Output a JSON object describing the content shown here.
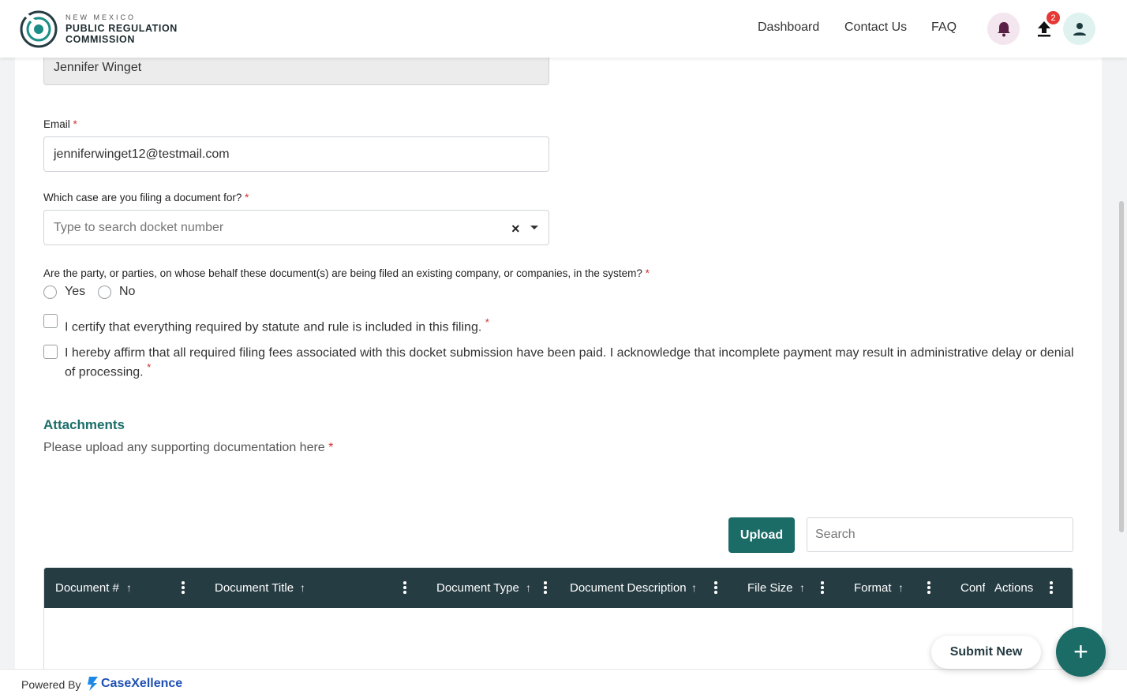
{
  "header": {
    "org_line1": "NEW MEXICO",
    "org_line2": "PUBLIC REGULATION",
    "org_line3": "COMMISSION",
    "nav": [
      "Dashboard",
      "Contact Us",
      "FAQ"
    ],
    "upload_badge": "2"
  },
  "form": {
    "name_value": "Jennifer Winget",
    "email_label": "Email",
    "email_value": "jenniferwinget12@testmail.com",
    "case_label": "Which case are you filing a document for?",
    "case_placeholder": "Type to search docket number",
    "party_question": "Are the party, or parties, on whose behalf these document(s) are being filed an existing company, or companies, in the system?",
    "radio_yes": "Yes",
    "radio_no": "No",
    "certify_text": "I certify that everything required by statute and rule is included in this filing.",
    "affirm_text": "I hereby affirm that all required filing fees associated with this docket submission have been paid. I acknowledge that incomplete payment may result in administrative delay or denial of processing.",
    "required_mark": "*"
  },
  "attachments": {
    "title": "Attachments",
    "subtitle": "Please upload any supporting documentation here",
    "upload_label": "Upload",
    "search_placeholder": "Search",
    "columns": [
      "Document #",
      "Document Title",
      "Document Type",
      "Document Description",
      "File Size",
      "Format",
      "Conf",
      "Actions"
    ]
  },
  "actions": {
    "submit_new": "Submit New",
    "fab_symbol": "+"
  },
  "footer": {
    "powered_by": "Powered By",
    "brand": "CaseXellence"
  },
  "colors": {
    "accent": "#1b6b66",
    "table_header": "#263c43",
    "required": "#d32f2f"
  }
}
